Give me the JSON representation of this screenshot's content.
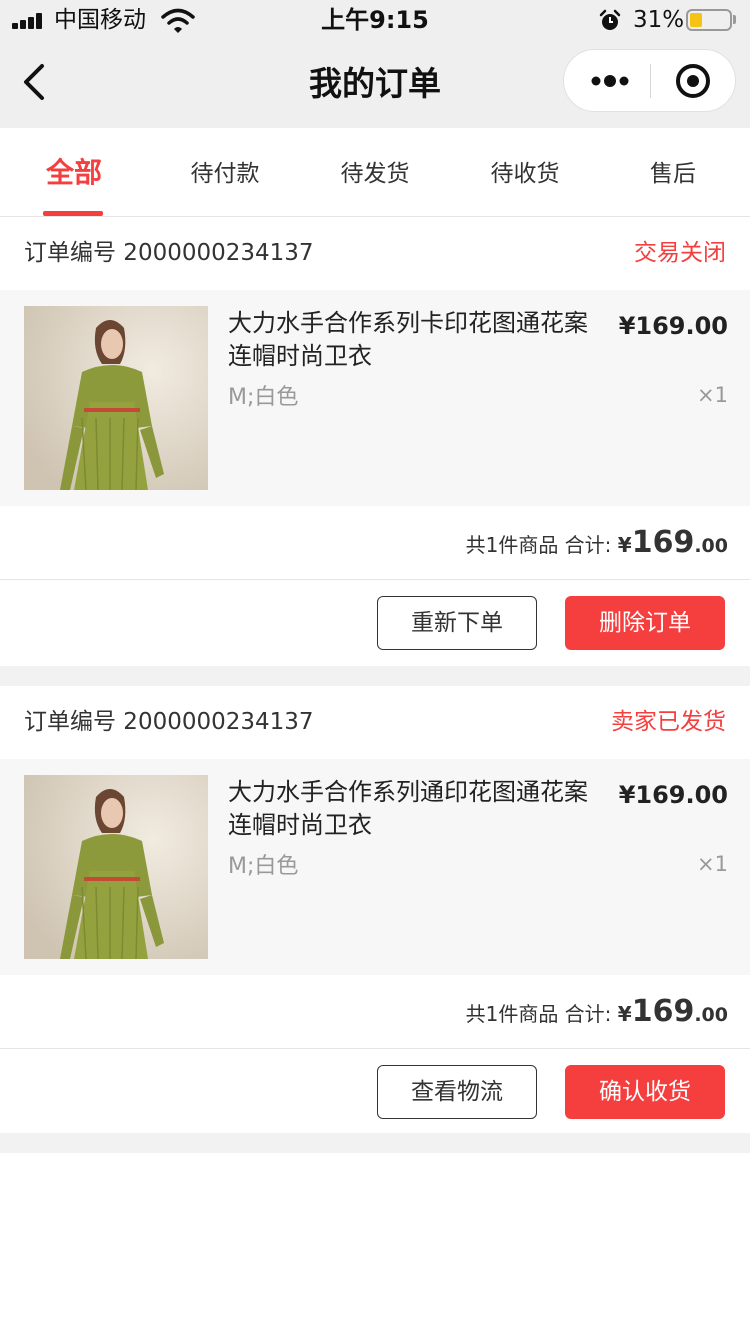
{
  "status_bar": {
    "carrier": "中国移动",
    "time": "上午9:15",
    "battery_percent": "31%",
    "battery_level": 0.31
  },
  "nav": {
    "title": "我的订单"
  },
  "tabs": [
    {
      "label": "全部",
      "active": true
    },
    {
      "label": "待付款",
      "active": false
    },
    {
      "label": "待发货",
      "active": false
    },
    {
      "label": "待收货",
      "active": false
    },
    {
      "label": "售后",
      "active": false
    }
  ],
  "orders": [
    {
      "order_no": "订单编号 2000000234137",
      "status": "交易关闭",
      "item": {
        "name": "大力水手合作系列卡印花图通花案连帽时尚卫衣",
        "spec": "M;白色",
        "price": "¥169.00",
        "qty": "×1"
      },
      "summary": {
        "count_text": "共1件商品 合计:",
        "currency": "¥",
        "amount_int": "169",
        "amount_dec": ".00"
      },
      "buttons": {
        "secondary": "重新下单",
        "primary": "删除订单"
      }
    },
    {
      "order_no": "订单编号 2000000234137",
      "status": "卖家已发货",
      "item": {
        "name": "大力水手合作系列通印花图通花案连帽时尚卫衣",
        "spec": "M;白色",
        "price": "¥169.00",
        "qty": "×1"
      },
      "summary": {
        "count_text": "共1件商品 合计:",
        "currency": "¥",
        "amount_int": "169",
        "amount_dec": ".00"
      },
      "buttons": {
        "secondary": "查看物流",
        "primary": "确认收货"
      }
    }
  ],
  "colors": {
    "accent": "#f53f3f",
    "background": "#f2f2f2",
    "goods_bg": "#f7f7f7",
    "dress": "#8a9a3a"
  }
}
